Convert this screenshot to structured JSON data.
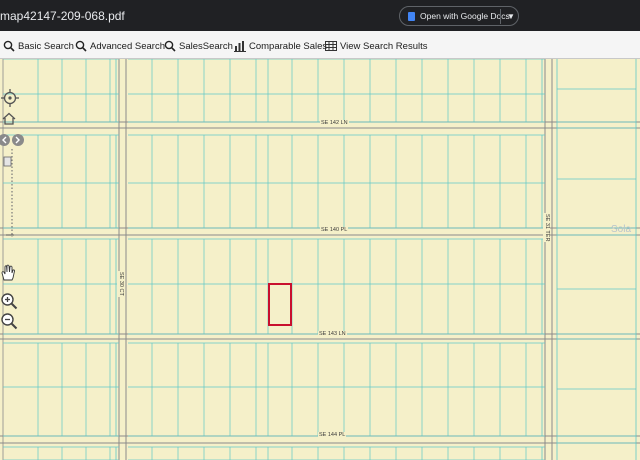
{
  "window": {
    "filename": "map42147-209-068.pdf"
  },
  "open_with": {
    "label": "Open with Google Docs",
    "icon": "google-docs-icon",
    "dropdown_icon": "caret-down-icon"
  },
  "toolbar": {
    "items": [
      {
        "label": "Basic Search",
        "icon": "magnifier-icon"
      },
      {
        "label": "Advanced Search",
        "icon": "magnifier-icon"
      },
      {
        "label": "SalesSearch",
        "icon": "magnifier-icon"
      },
      {
        "label": "Comparable Sales",
        "icon": "bar-chart-icon"
      },
      {
        "label": "View Search Results",
        "icon": "table-grid-icon"
      }
    ]
  },
  "map": {
    "road_labels": {
      "se142": "SE 142 LN",
      "se140": "SE 140 PL",
      "se143": "SE 143 LN",
      "se144": "SE 144 PL",
      "se30": "SE 30 CT",
      "se31": "SE 31 TER"
    },
    "faint_label": "Sola",
    "colors": {
      "background": "#f5f0c9",
      "lot_lines": "#5fc8c8",
      "road_edges": "#8a8a8a",
      "subject_parcel": "#c8102e"
    }
  },
  "controls": [
    "pan-crosshair-icon",
    "home-icon",
    "pan-left-icon",
    "pan-right-icon",
    "zoom-slider",
    "hand-pan-icon",
    "zoom-in-icon",
    "zoom-out-icon"
  ]
}
